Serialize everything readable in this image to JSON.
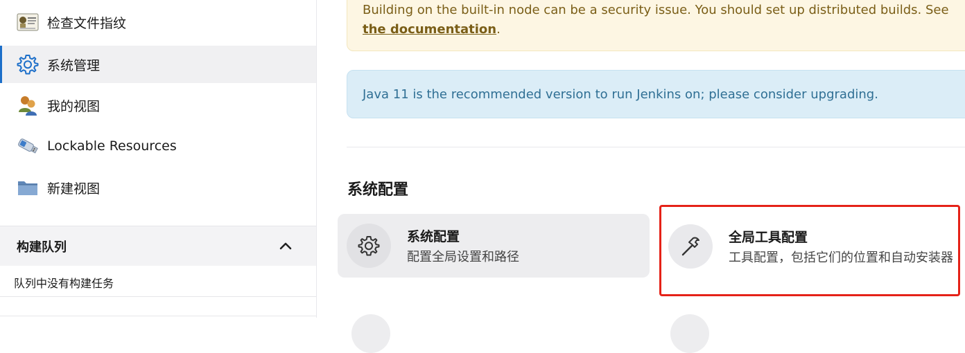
{
  "sidebar": {
    "items": [
      {
        "label": "检查文件指纹",
        "icon": "fingerprint-document-icon",
        "active": false
      },
      {
        "label": "系统管理",
        "icon": "gear-icon",
        "active": true
      },
      {
        "label": "我的视图",
        "icon": "user-group-icon",
        "active": false
      },
      {
        "label": "Lockable Resources",
        "icon": "usb-drive-icon",
        "active": false
      },
      {
        "label": "新建视图",
        "icon": "folder-icon",
        "active": false
      }
    ],
    "queue": {
      "title": "构建队列",
      "toggle_icon": "chevron-up-icon",
      "empty_text": "队列中没有构建任务"
    }
  },
  "main": {
    "alerts": {
      "warning_text": "Building on the built-in node can be a security issue. You should set up distributed builds. See ",
      "warning_link": "the documentation",
      "warning_suffix": ".",
      "info_text": "Java 11 is the recommended version to run Jenkins on; please consider upgrading."
    },
    "section_title": "系统配置",
    "cards": [
      {
        "title": "系统配置",
        "description": "配置全局设置和路径",
        "icon": "gear-icon"
      },
      {
        "title": "全局工具配置",
        "description": "工具配置，包括它们的位置和自动安装器",
        "icon": "hammer-icon",
        "highlighted": true
      }
    ]
  },
  "colors": {
    "accent": "#1d6fc9",
    "highlight_border": "#e52218",
    "warning_bg": "#fdf6e3",
    "info_bg": "#dbedf7"
  }
}
